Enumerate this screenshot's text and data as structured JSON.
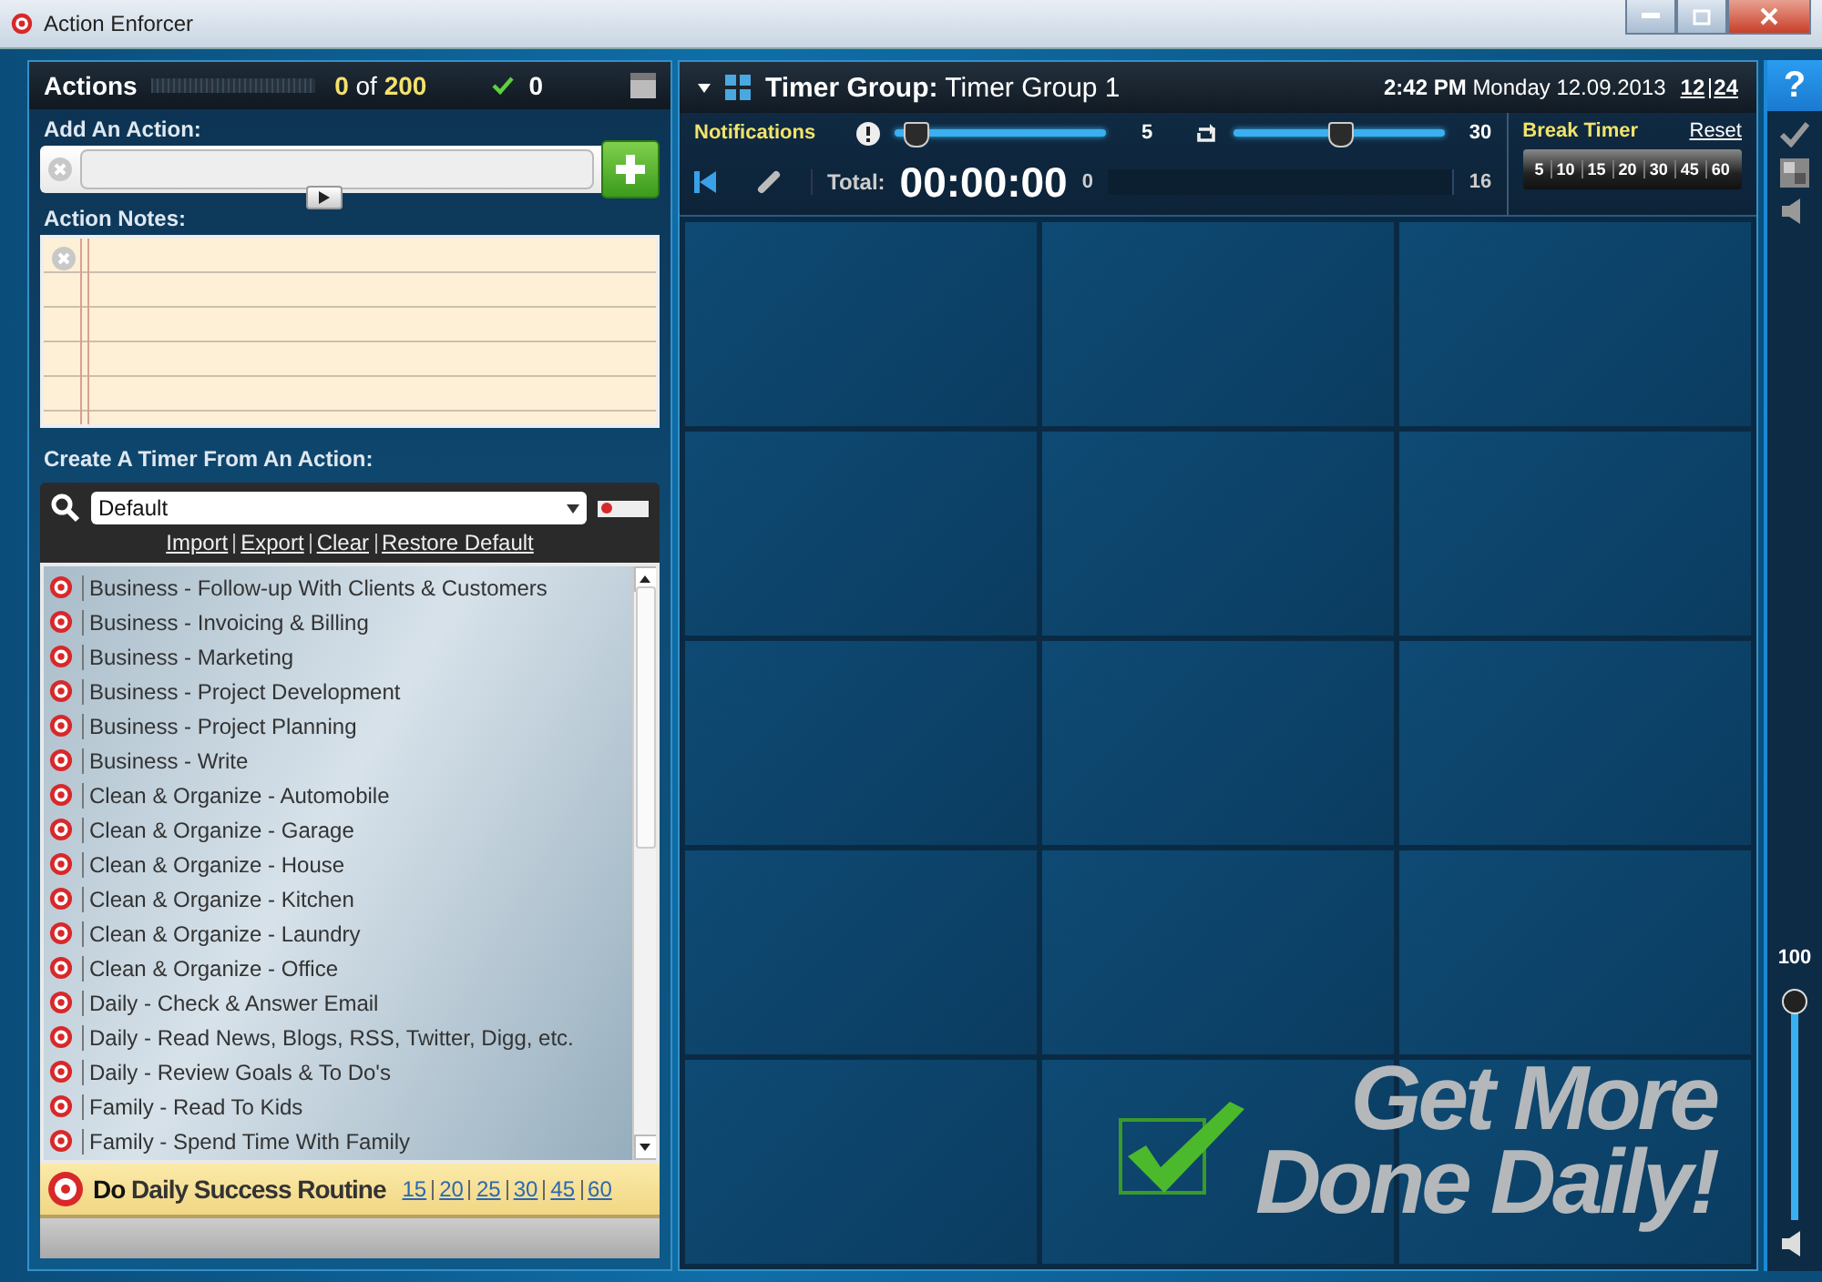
{
  "window": {
    "title": "Action Enforcer"
  },
  "actions": {
    "title": "Actions",
    "count": "0",
    "of": "of",
    "total": "200",
    "done": "0",
    "add_label": "Add An Action:",
    "notes_label": "Action Notes:",
    "timer_label": "Create A Timer From An Action:",
    "preset": {
      "value": "Default"
    },
    "links": [
      "Import",
      "Export",
      "Clear",
      "Restore Default"
    ],
    "items": [
      "Business - Follow-up With Clients & Customers",
      "Business - Invoicing & Billing",
      "Business - Marketing",
      "Business - Project Development",
      "Business - Project Planning",
      "Business - Write",
      "Clean & Organize - Automobile",
      "Clean & Organize - Garage",
      "Clean & Organize - House",
      "Clean & Organize - Kitchen",
      "Clean & Organize - Laundry",
      "Clean & Organize - Office",
      "Daily - Check & Answer Email",
      "Daily - Read News, Blogs, RSS, Twitter, Digg, etc.",
      "Daily - Review Goals & To Do's",
      "Family - Read To Kids",
      "Family - Spend Time With Family"
    ],
    "routine": {
      "label": "**Do** Daily Success Routine",
      "minutes": [
        "15",
        "20",
        "25",
        "30",
        "45",
        "60"
      ]
    }
  },
  "timer": {
    "group_label": "Timer Group:",
    "group_name": "Timer Group 1",
    "time": "2:42 PM",
    "date": "Monday 12.09.2013",
    "formats": [
      "12",
      "24"
    ],
    "notifications": "Notifications",
    "sliders": [
      {
        "kind": "alert",
        "level": 0.05,
        "reading": "5"
      },
      {
        "kind": "repeat",
        "level": 0.5,
        "reading": "30"
      }
    ],
    "break_label": "Break Timer",
    "reset": "Reset",
    "break_options": [
      "5",
      "10",
      "15",
      "20",
      "30",
      "45",
      "60"
    ],
    "total_label": "Total:",
    "total": "00:00:00",
    "range_start": "0",
    "range_end": "16"
  },
  "slogan": [
    "Get More",
    "Done Daily!"
  ],
  "side": {
    "help": "?",
    "volume": "100",
    "volume_slider": {
      "level": 1.0
    }
  }
}
